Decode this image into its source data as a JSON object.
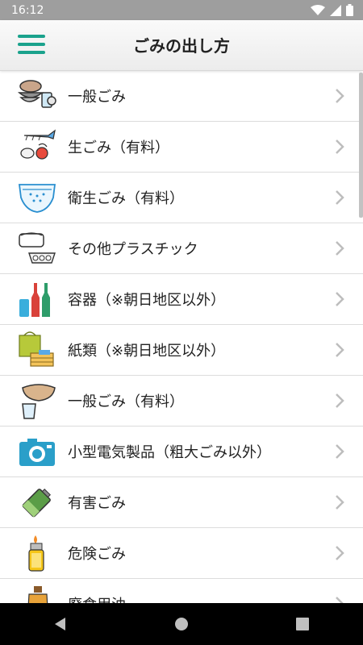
{
  "status_bar": {
    "time": "16:12"
  },
  "app_bar": {
    "title": "ごみの出し方",
    "menu_icon": "hamburger-menu-icon"
  },
  "list": {
    "items": [
      {
        "label": "一般ごみ",
        "icon": "dishes-icon"
      },
      {
        "label": "生ごみ（有料）",
        "icon": "food-waste-icon"
      },
      {
        "label": "衛生ごみ（有料）",
        "icon": "diaper-icon"
      },
      {
        "label": "その他プラスチック",
        "icon": "plastic-containers-icon"
      },
      {
        "label": "容器（※朝日地区以外）",
        "icon": "bottles-cans-icon"
      },
      {
        "label": "紙類（※朝日地区以外）",
        "icon": "paper-bag-icon"
      },
      {
        "label": "一般ごみ（有料）",
        "icon": "bowl-cup-icon"
      },
      {
        "label": "小型電気製品（粗大ごみ以外）",
        "icon": "camera-icon"
      },
      {
        "label": "有害ごみ",
        "icon": "battery-icon"
      },
      {
        "label": "危険ごみ",
        "icon": "lighter-icon"
      },
      {
        "label": "廃食用油",
        "icon": "oil-bottle-icon"
      }
    ]
  },
  "colors": {
    "accent": "#1aa28c",
    "status_bar": "#9e9e9e",
    "nav_bar": "#000000"
  }
}
